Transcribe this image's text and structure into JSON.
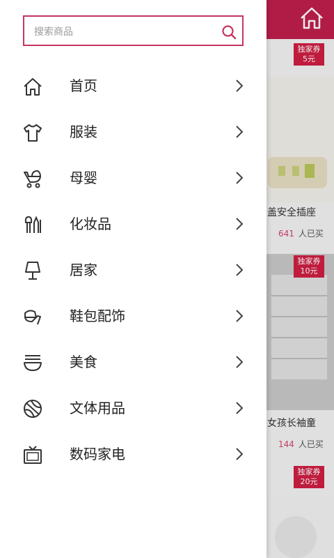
{
  "search": {
    "placeholder": "搜索商品"
  },
  "menu": {
    "items": [
      {
        "label": "首页",
        "icon": "home-icon"
      },
      {
        "label": "服装",
        "icon": "shirt-icon"
      },
      {
        "label": "母婴",
        "icon": "stroller-icon"
      },
      {
        "label": "化妆品",
        "icon": "cosmetics-icon"
      },
      {
        "label": "居家",
        "icon": "lamp-icon"
      },
      {
        "label": "鞋包配饰",
        "icon": "shoe-icon"
      },
      {
        "label": "美食",
        "icon": "bowl-icon"
      },
      {
        "label": "文体用品",
        "icon": "ball-icon"
      },
      {
        "label": "数码家电",
        "icon": "tv-icon"
      }
    ]
  },
  "background": {
    "coupons": [
      {
        "line1": "独家券",
        "line2": "5元"
      },
      {
        "line1": "独家券",
        "line2": "10元"
      },
      {
        "line1": "独家券",
        "line2": "20元"
      }
    ],
    "products": [
      {
        "title": "盖安全插座",
        "sold_count": "641",
        "sold_suffix": "人已买"
      },
      {
        "title": "女孩长袖童",
        "sold_count": "144",
        "sold_suffix": "人已买"
      }
    ]
  },
  "colors": {
    "accent": "#c6345f",
    "header": "#c01f4c",
    "coupon": "#d01f43"
  }
}
